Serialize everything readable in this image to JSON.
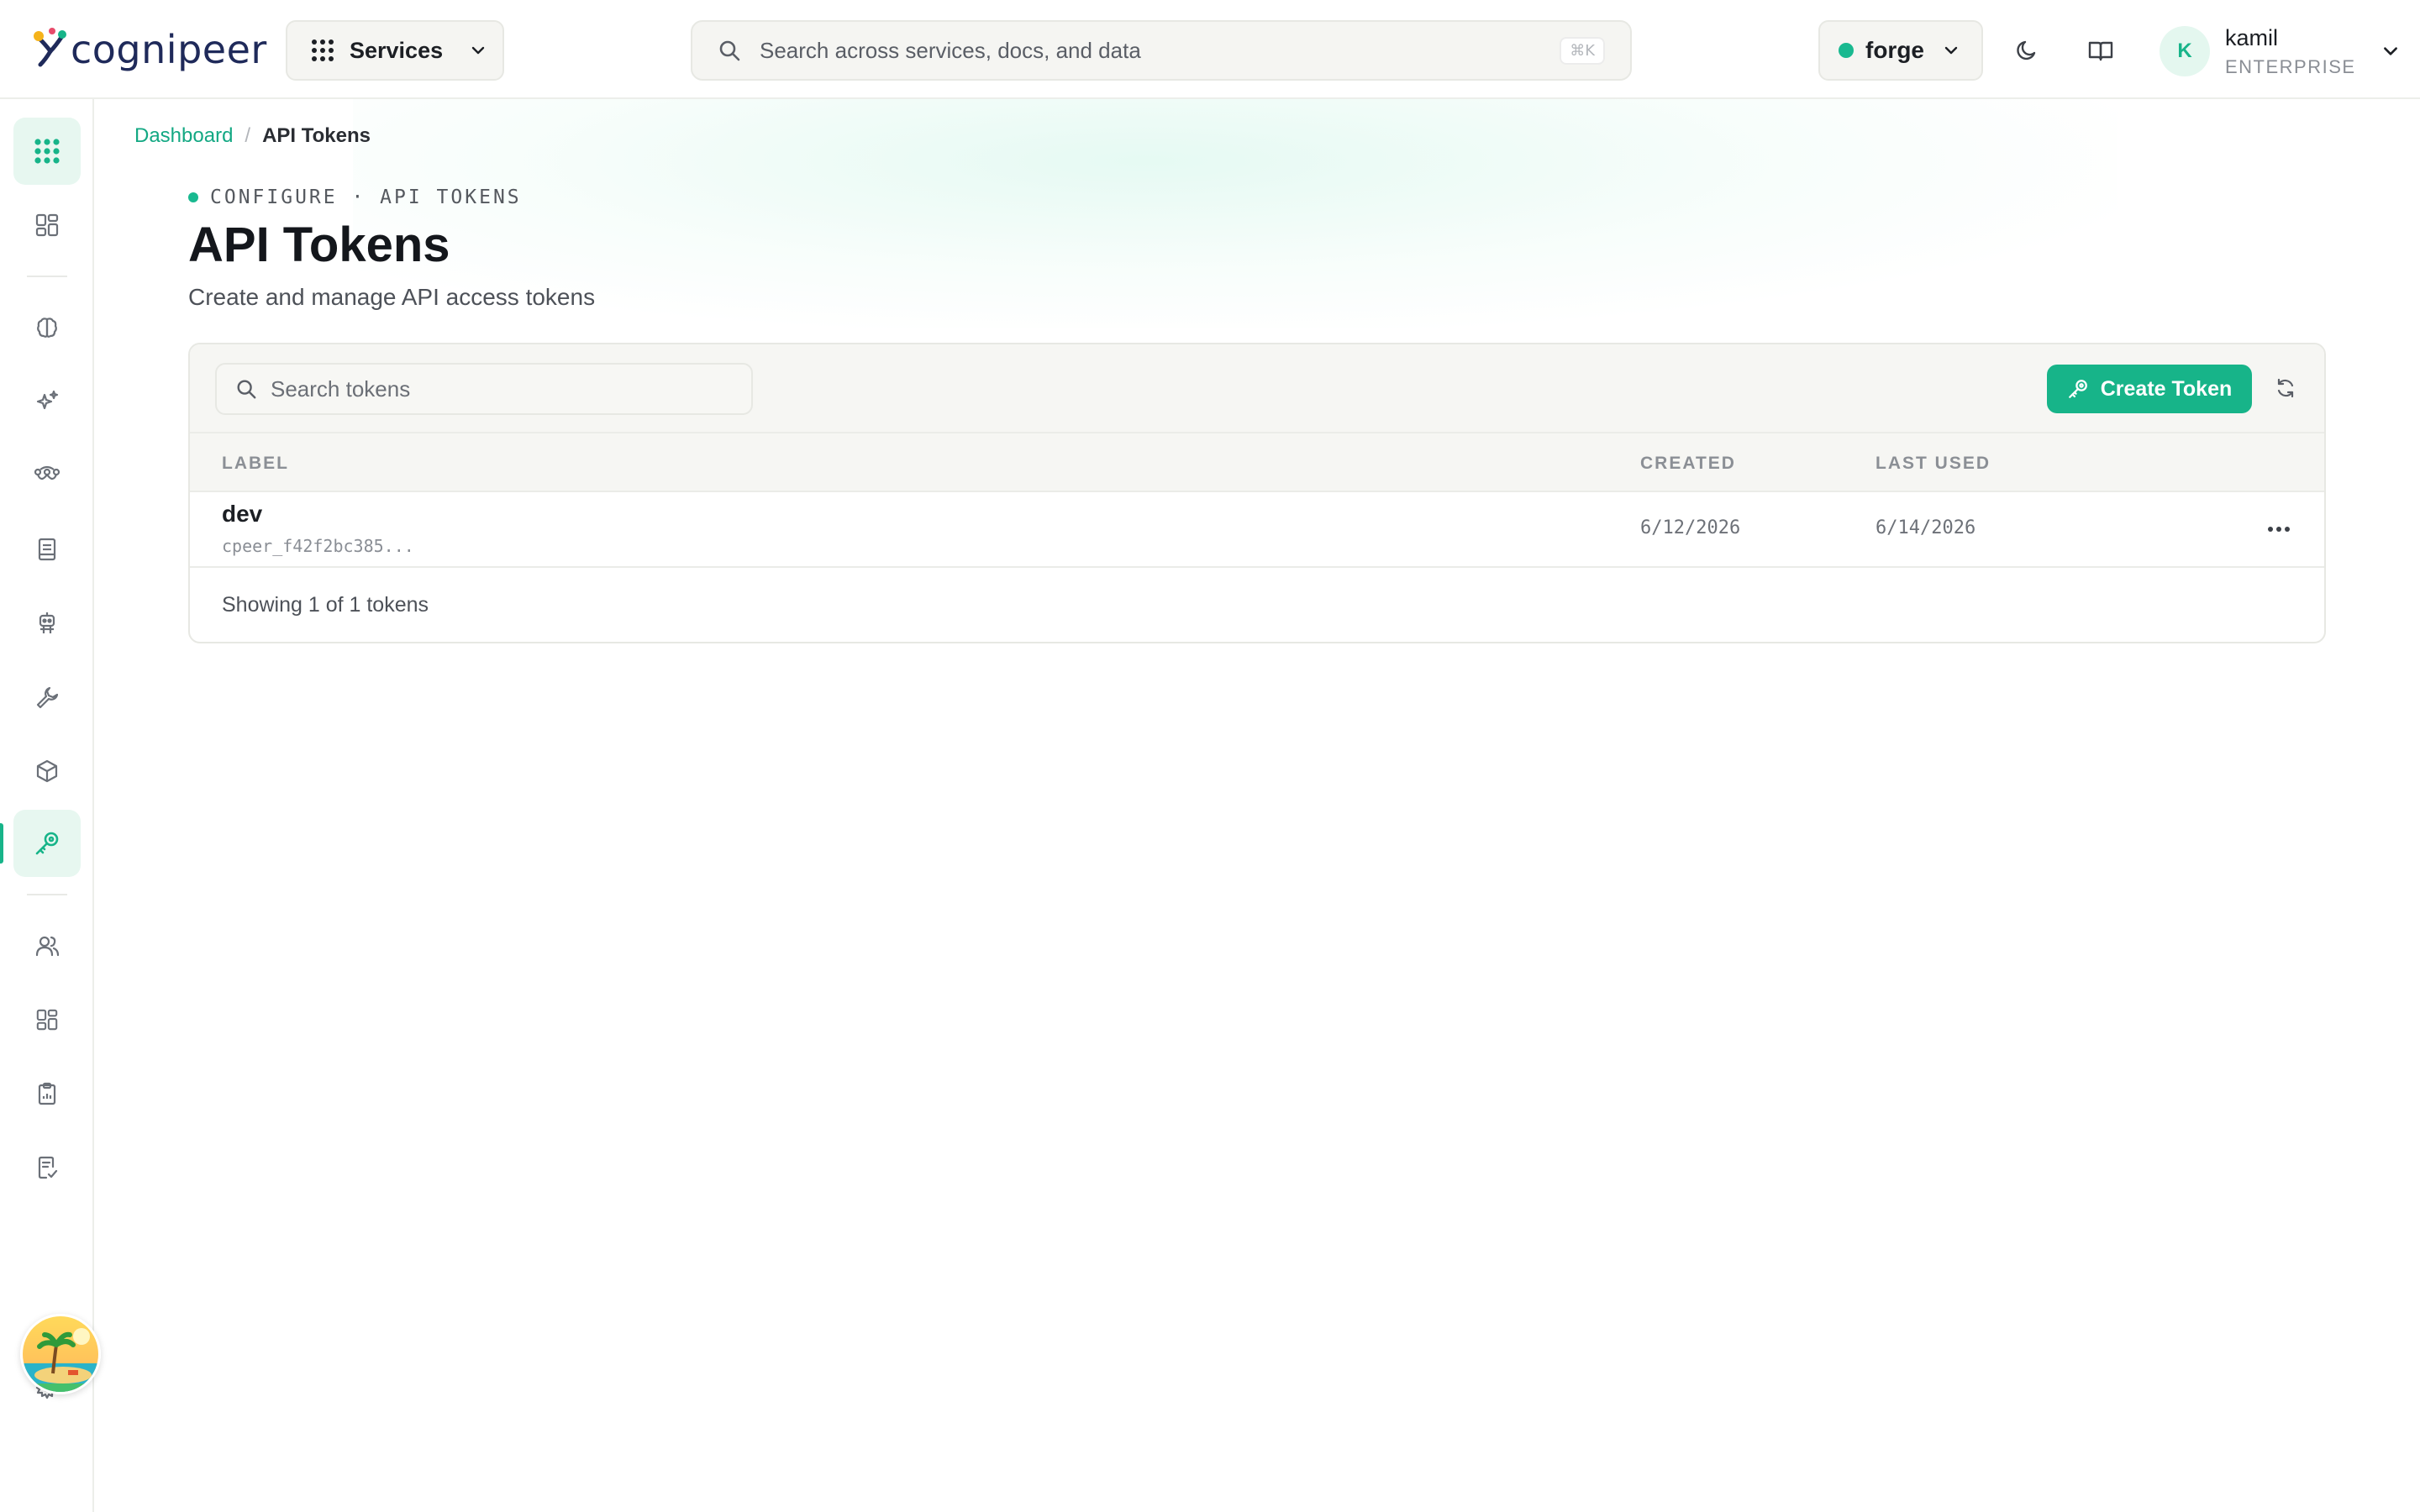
{
  "brand": {
    "name": "cognipeer"
  },
  "topbar": {
    "services_label": "Services",
    "search_placeholder": "Search across services, docs, and data",
    "search_shortcut": "⌘K",
    "workspace": {
      "name": "forge",
      "status_color": "#19b990"
    },
    "user": {
      "initial": "K",
      "name": "kamil",
      "plan": "ENTERPRISE"
    }
  },
  "sidebar": {
    "items": [
      {
        "name": "apps-grid",
        "icon": "grid-dots-icon",
        "active": false,
        "highlight": true
      },
      {
        "name": "dashboard",
        "icon": "layout-dashboard-icon"
      },
      {
        "name": "models",
        "icon": "brain-icon"
      },
      {
        "name": "ai-studio",
        "icon": "sparkles-icon"
      },
      {
        "name": "flows",
        "icon": "route-icon"
      },
      {
        "name": "docs",
        "icon": "book-icon"
      },
      {
        "name": "agents",
        "icon": "robot-icon"
      },
      {
        "name": "tools",
        "icon": "wrench-icon"
      },
      {
        "name": "packages",
        "icon": "cube-icon"
      },
      {
        "name": "api-tokens",
        "icon": "key-icon",
        "active": true
      },
      {
        "name": "users",
        "icon": "users-icon"
      },
      {
        "name": "apps",
        "icon": "layout-icon"
      },
      {
        "name": "reports",
        "icon": "clipboard-icon"
      },
      {
        "name": "audit",
        "icon": "file-check-icon"
      },
      {
        "name": "settings",
        "icon": "gear-icon"
      }
    ],
    "accent": "#17b489"
  },
  "breadcrumb": {
    "home": "Dashboard",
    "separator": "/",
    "current": "API Tokens"
  },
  "header": {
    "eyebrow": "CONFIGURE · API TOKENS",
    "title": "API Tokens",
    "subtitle": "Create and manage API access tokens"
  },
  "tokens": {
    "search_placeholder": "Search tokens",
    "create_label": "Create Token",
    "columns": {
      "label": "LABEL",
      "created": "CREATED",
      "last_used": "LAST USED"
    },
    "rows": [
      {
        "label": "dev",
        "key": "cpeer_f42f2bc385...",
        "created": "6/12/2026",
        "last_used": "6/14/2026"
      }
    ],
    "footer": "Showing 1 of 1 tokens"
  }
}
